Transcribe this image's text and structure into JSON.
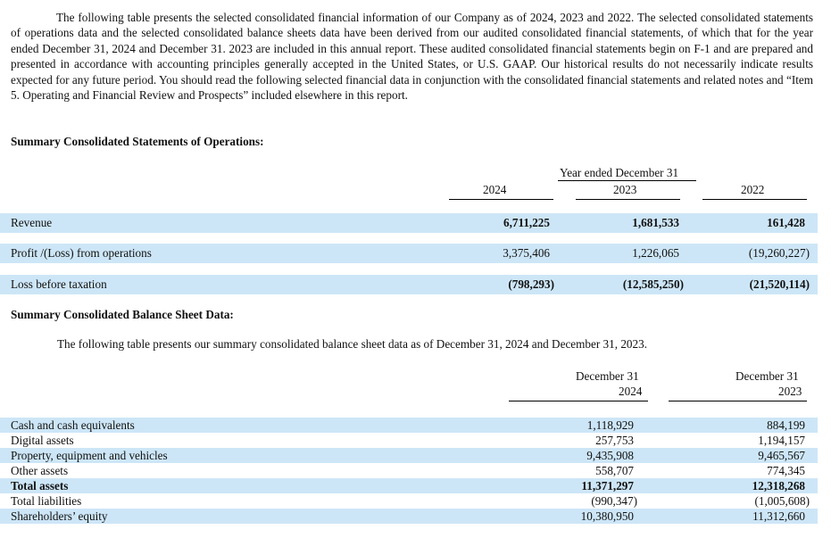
{
  "intro_paragraph": "The following table presents the selected consolidated financial information of our Company as of 2024, 2023 and 2022. The selected consolidated statements of operations data and the selected consolidated balance sheets data have been derived from our audited consolidated financial statements, of which that for the year ended December 31, 2024 and December 31. 2023 are included in this annual report. These audited consolidated financial statements begin on F-1 and are prepared and presented in accordance with accounting principles generally accepted in the United States, or U.S. GAAP. Our historical results do not necessarily indicate results expected for any future period. You should read the following selected financial data in conjunction with the consolidated financial statements and related notes and “Item 5. Operating and Financial Review and Prospects” included elsewhere in this report.",
  "operations": {
    "heading": "Summary Consolidated Statements of Operations:",
    "group_header": "Year ended December 31",
    "columns": [
      "2024",
      "2023",
      "2022"
    ],
    "rows": [
      {
        "label": "Revenue",
        "values": [
          "6,711,225",
          "1,681,533",
          "161,428"
        ],
        "bold_values": true
      },
      {
        "label": "Profit /(Loss) from operations",
        "values": [
          "3,375,406",
          "1,226,065",
          "(19,260,227)"
        ],
        "bold_values": false
      },
      {
        "label": "Loss before taxation",
        "values": [
          "(798,293)",
          "(12,585,250)",
          "(21,520,114)"
        ],
        "bold_values": true
      }
    ]
  },
  "balance_sheet": {
    "heading": "Summary Consolidated Balance Sheet Data:",
    "intro": "The following table presents our summary consolidated balance sheet data as of December 31, 2024 and December 31, 2023.",
    "columns": [
      {
        "line1": "December 31",
        "line2": "2024"
      },
      {
        "line1": "December 31",
        "line2": "2023"
      }
    ],
    "rows": [
      {
        "label": "Cash and cash equivalents",
        "values": [
          "1,118,929",
          "884,199"
        ],
        "bold": false
      },
      {
        "label": "Digital assets",
        "values": [
          "257,753",
          "1,194,157"
        ],
        "bold": false
      },
      {
        "label": "Property, equipment and vehicles",
        "values": [
          "9,435,908",
          "9,465,567"
        ],
        "bold": false
      },
      {
        "label": "Other assets",
        "values": [
          "558,707",
          "774,345"
        ],
        "bold": false
      },
      {
        "label": "Total assets",
        "values": [
          "11,371,297",
          "12,318,268"
        ],
        "bold": true
      },
      {
        "label": "Total liabilities",
        "values": [
          "(990,347)",
          "(1,005,608)"
        ],
        "bold": false
      },
      {
        "label": "Shareholders’ equity",
        "values": [
          "10,380,950",
          "11,312,660"
        ],
        "bold": false
      }
    ]
  },
  "colors": {
    "row_band": "#cde6f7"
  }
}
